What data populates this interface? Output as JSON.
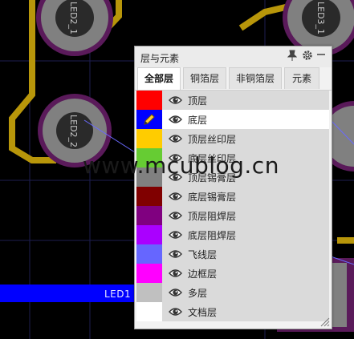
{
  "canvas": {
    "pads": [
      {
        "label": "LED2_1"
      },
      {
        "label": "LED3_1"
      },
      {
        "label": "LED2_2"
      }
    ],
    "net_label": "LED1"
  },
  "panel": {
    "title": "层与元素",
    "tabs": [
      {
        "label": "全部层",
        "active": true
      },
      {
        "label": "铜箔层",
        "active": false
      },
      {
        "label": "非铜箔层",
        "active": false
      },
      {
        "label": "元素",
        "active": false
      }
    ],
    "layers": [
      {
        "name": "顶层",
        "color": "#ff0000",
        "selected": false
      },
      {
        "name": "底层",
        "color": "#0000ff",
        "selected": true
      },
      {
        "name": "顶层丝印层",
        "color": "#ffcc00",
        "selected": false
      },
      {
        "name": "底层丝印层",
        "color": "#66cc33",
        "selected": false
      },
      {
        "name": "顶层锡膏层",
        "color": "#808080",
        "selected": false
      },
      {
        "name": "底层锡膏层",
        "color": "#800000",
        "selected": false
      },
      {
        "name": "顶层阻焊层",
        "color": "#800080",
        "selected": false
      },
      {
        "name": "底层阻焊层",
        "color": "#aa00ff",
        "selected": false
      },
      {
        "name": "飞线层",
        "color": "#6666ff",
        "selected": false
      },
      {
        "name": "边框层",
        "color": "#ff00ff",
        "selected": false
      },
      {
        "name": "多层",
        "color": "#c0c0c0",
        "selected": false
      },
      {
        "name": "文档层",
        "color": "#ffffff",
        "selected": false
      }
    ]
  },
  "watermark": "www.mcublog.cn"
}
